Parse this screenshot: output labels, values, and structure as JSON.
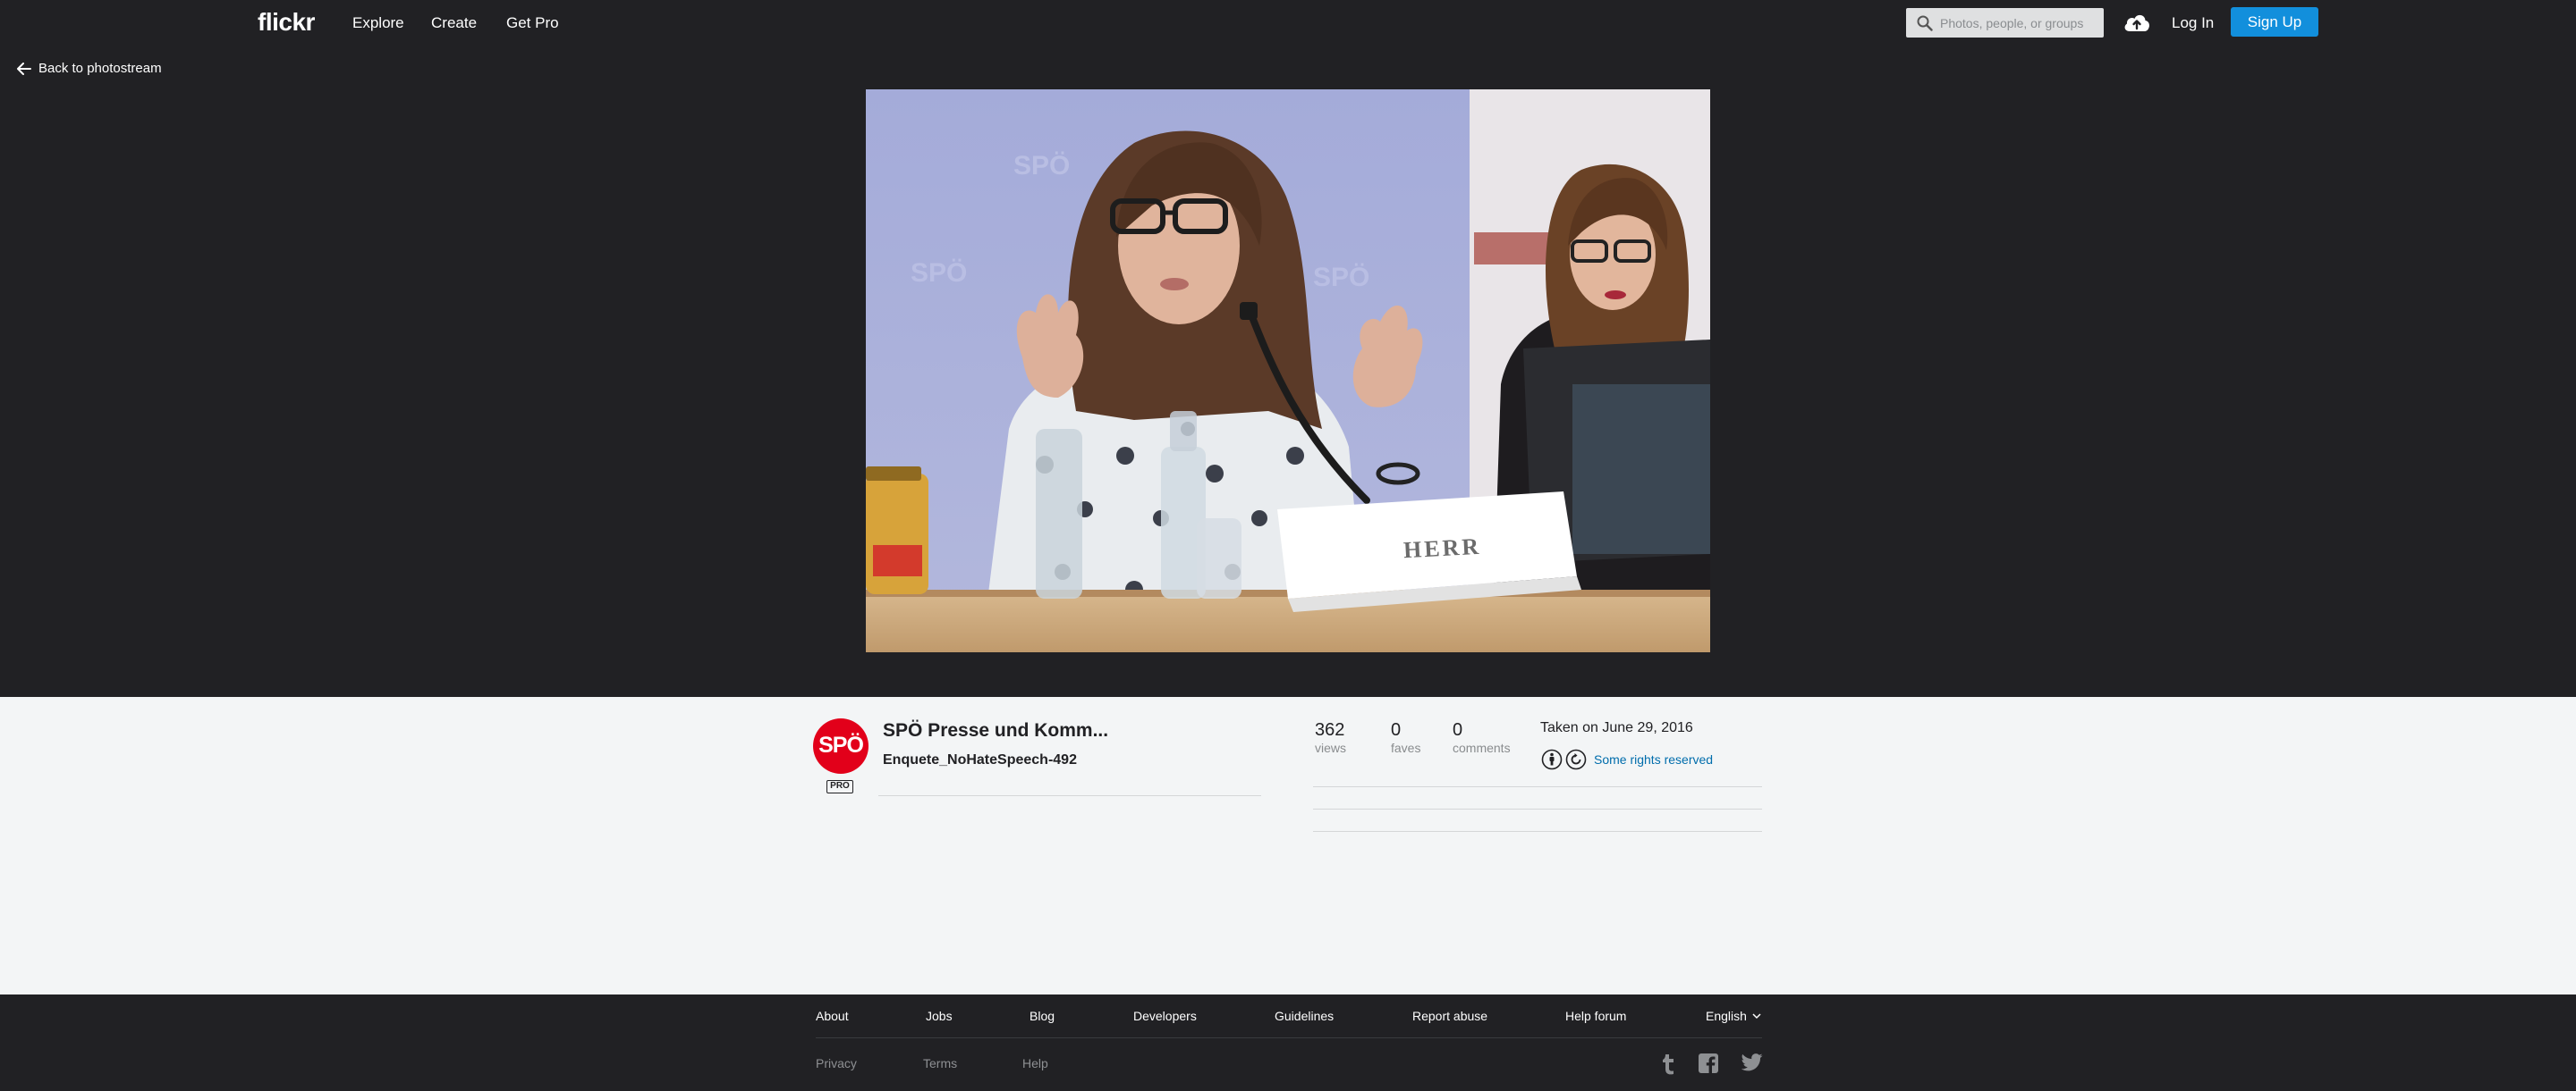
{
  "nav": {
    "logo": "flickr",
    "explore": "Explore",
    "create": "Create",
    "get_pro": "Get Pro",
    "search_placeholder": "Photos, people, or groups",
    "log_in": "Log In",
    "sign_up": "Sign Up"
  },
  "photo_view": {
    "back_label": "Back to photostream",
    "image_sign_text": "HERR",
    "backdrop_text": "SPÖ"
  },
  "owner": {
    "avatar_text": "SPÖ",
    "pro_label": "PRO",
    "name": "SPÖ Presse und Komm...",
    "photo_title": "Enquete_NoHateSpeech-492"
  },
  "stats": {
    "views_count": "362",
    "views_label": "views",
    "faves_count": "0",
    "faves_label": "faves",
    "comments_count": "0",
    "comments_label": "comments"
  },
  "meta": {
    "taken": "Taken on June 29, 2016",
    "license": "Some rights reserved"
  },
  "footer": {
    "about": "About",
    "jobs": "Jobs",
    "blog": "Blog",
    "developers": "Developers",
    "guidelines": "Guidelines",
    "report_abuse": "Report abuse",
    "help_forum": "Help forum",
    "language": "English",
    "privacy": "Privacy",
    "terms": "Terms",
    "help": "Help"
  },
  "colors": {
    "nav_bg": "#212124",
    "accent_blue": "#128fdc",
    "link_blue": "#006dac",
    "brand_red": "#e2001a"
  }
}
